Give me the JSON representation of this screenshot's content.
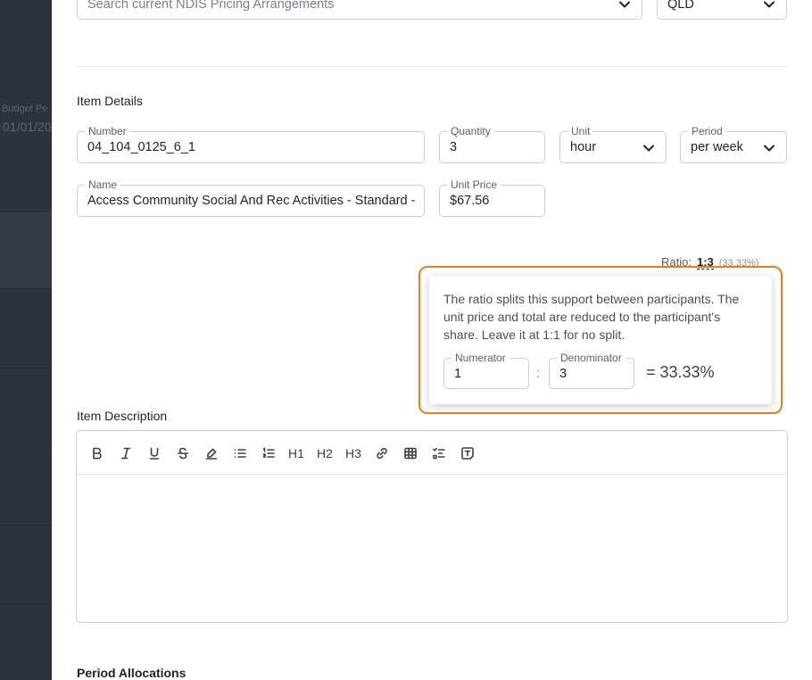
{
  "background": {
    "budget_label": "Budget Pe",
    "budget_date": "01/01/20"
  },
  "search": {
    "placeholder": "Search current NDIS Pricing Arrangements",
    "state_value": "QLD"
  },
  "item_details": {
    "title": "Item Details",
    "number": {
      "label": "Number",
      "value": "04_104_0125_6_1"
    },
    "quantity": {
      "label": "Quantity",
      "value": "3"
    },
    "unit": {
      "label": "Unit",
      "value": "hour"
    },
    "period": {
      "label": "Period",
      "value": "per week"
    },
    "name": {
      "label": "Name",
      "value": "Access Community Social And Rec Activities - Standard - W"
    },
    "unit_price": {
      "label": "Unit Price",
      "value": "$67.56"
    }
  },
  "ratio": {
    "label": "Ratio:",
    "value": "1:3",
    "percent": "(33.33%)"
  },
  "ratio_popover": {
    "message": "The ratio splits this support between participants. The unit price and total are reduced to the participant's share. Leave it at 1:1 for no split.",
    "numerator": {
      "label": "Numerator",
      "value": "1"
    },
    "separator": ":",
    "denominator": {
      "label": "Denominator",
      "value": "3"
    },
    "result": "= 33.33%"
  },
  "description": {
    "title": "Item Description",
    "toolbar": {
      "h1": "H1",
      "h2": "H2",
      "h3": "H3"
    }
  },
  "period_allocations": {
    "title": "Period Allocations"
  },
  "colors": {
    "accent_outline": "#f07a1e",
    "sidebar": "#2d333d"
  }
}
